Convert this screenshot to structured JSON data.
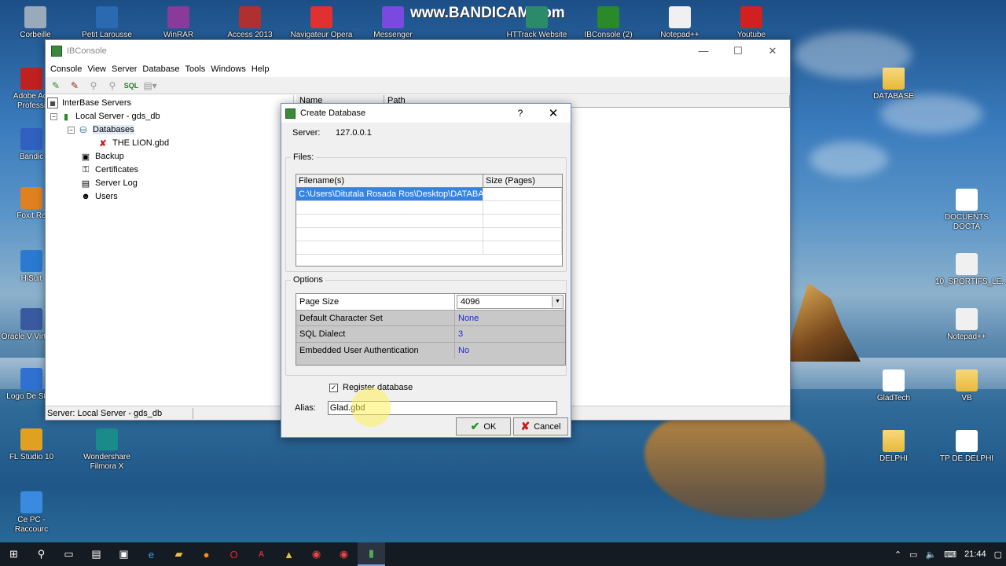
{
  "watermark": "www.BANDICAM.com",
  "desktop_icons": [
    {
      "label": "Corbeille",
      "icon": "recycle-bin-icon"
    },
    {
      "label": "Petit Larousse",
      "icon": "app-icon"
    },
    {
      "label": "WinRAR",
      "icon": "winrar-icon"
    },
    {
      "label": "Access 2013",
      "icon": "access-icon"
    },
    {
      "label": "Navigateur Opera",
      "icon": "opera-icon"
    },
    {
      "label": "Messenger",
      "icon": "messenger-icon"
    },
    {
      "label": "HTTrack Website",
      "icon": "httrack-icon"
    },
    {
      "label": "IBConsole (2)",
      "icon": "ibconsole-icon"
    },
    {
      "label": "Notepad++",
      "icon": "notepad-icon"
    },
    {
      "label": "Youtube",
      "icon": "youtube-icon"
    },
    {
      "label": "Adobe Acr Professi",
      "icon": "pdf-icon"
    },
    {
      "label": "Bandic",
      "icon": "bandicam-icon"
    },
    {
      "label": "Foxit Re",
      "icon": "foxit-icon"
    },
    {
      "label": "HiSuit",
      "icon": "hisuite-icon"
    },
    {
      "label": "Oracle V VirtualB",
      "icon": "virtualbox-icon"
    },
    {
      "label": "Logo De Studi",
      "icon": "logo-icon"
    },
    {
      "label": "FL Studio 10",
      "icon": "flstudio-icon"
    },
    {
      "label": "Wondershare Filmora X",
      "icon": "filmora-icon"
    },
    {
      "label": "Ce PC - Raccourc",
      "icon": "pc-icon"
    },
    {
      "label": "DATABASE",
      "icon": "folder-icon"
    },
    {
      "label": "DOCUENTS DOCTA",
      "icon": "doc-icon"
    },
    {
      "label": "10_SPORTIFS_LE...",
      "icon": "file-icon"
    },
    {
      "label": "Notepad++",
      "icon": "notepad-icon"
    },
    {
      "label": "GladTech",
      "icon": "doc-icon"
    },
    {
      "label": "VB",
      "icon": "folder-icon"
    },
    {
      "label": "DELPHI",
      "icon": "folder-icon"
    },
    {
      "label": "TP DE DELPHI",
      "icon": "doc-icon"
    }
  ],
  "window": {
    "title": "IBConsole",
    "menu": [
      "Console",
      "View",
      "Server",
      "Database",
      "Tools",
      "Windows",
      "Help"
    ],
    "tree": {
      "root": "InterBase Servers",
      "server": "Local Server - gds_db",
      "databases": "Databases",
      "db_file": "THE LION.gbd",
      "backup": "Backup",
      "certificates": "Certificates",
      "server_log": "Server Log",
      "users": "Users"
    },
    "columns": {
      "name": "Name",
      "path": "Path"
    },
    "status": "Server: Local Server - gds_db"
  },
  "dialog": {
    "title": "Create Database",
    "help": "?",
    "server_label": "Server:",
    "server_value": "127.0.0.1",
    "files_label": "Files:",
    "files_headers": {
      "filename": "Filename(s)",
      "size": "Size (Pages)"
    },
    "files_rows": [
      "C:\\Users\\Ditutala Rosada Ros\\Desktop\\DATABASE"
    ],
    "options_label": "Options",
    "options": [
      {
        "key": "Page Size",
        "value": "4096"
      },
      {
        "key": "Default Character Set",
        "value": "None"
      },
      {
        "key": "SQL Dialect",
        "value": "3"
      },
      {
        "key": "Embedded User Authentication",
        "value": "No"
      }
    ],
    "register_label": "Register database",
    "register_checked": true,
    "alias_label": "Alias:",
    "alias_value": "Glad.gbd",
    "ok_label": "OK",
    "cancel_label": "Cancel"
  },
  "taskbar": {
    "time": "21:44"
  }
}
